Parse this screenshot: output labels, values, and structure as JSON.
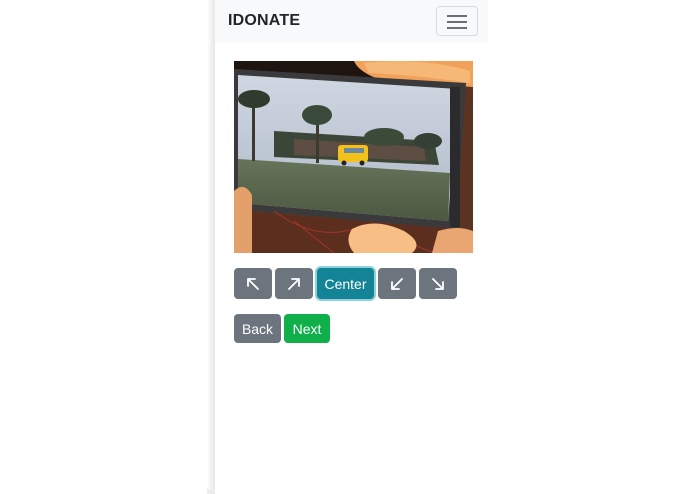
{
  "navbar": {
    "brand": "IDONATE"
  },
  "position_controls": {
    "up_left_icon": "arrow-up-left-icon",
    "up_right_icon": "arrow-up-right-icon",
    "center_label": "Center",
    "down_left_icon": "arrow-down-left-icon",
    "down_right_icon": "arrow-down-right-icon"
  },
  "actions": {
    "back_label": "Back",
    "next_label": "Next"
  },
  "colors": {
    "secondary": "#6c757d",
    "active": "#138496",
    "success": "#0fb04a",
    "navbar": "#f8f9fa"
  }
}
